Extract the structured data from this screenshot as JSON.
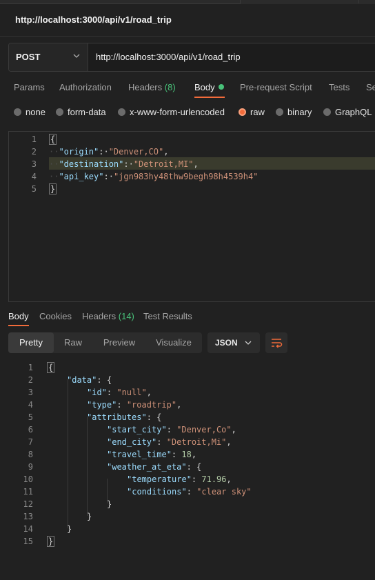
{
  "title": "http://localhost:3000/api/v1/road_trip",
  "request": {
    "method": "POST",
    "url": "http://localhost:3000/api/v1/road_trip"
  },
  "tabs": [
    {
      "label": "Params"
    },
    {
      "label": "Authorization"
    },
    {
      "label": "Headers",
      "count": "(8)"
    },
    {
      "label": "Body"
    },
    {
      "label": "Pre-request Script"
    },
    {
      "label": "Tests"
    },
    {
      "label": "Se"
    }
  ],
  "body_types": [
    "none",
    "form-data",
    "x-www-form-urlencoded",
    "raw",
    "binary",
    "GraphQL"
  ],
  "selected_body_type": "raw",
  "request_lines": [
    {
      "n": "1",
      "text": "{"
    },
    {
      "n": "2",
      "key": "\"origin\"",
      "value": "\"Denver,CO\"",
      "trail": ","
    },
    {
      "n": "3",
      "key": "\"destination\"",
      "value": "\"Detroit,MI\"",
      "trail": ","
    },
    {
      "n": "4",
      "key": "\"api_key\"",
      "value": "\"jgn983hy48thw9begh98h4539h4\"",
      "trail": ""
    },
    {
      "n": "5",
      "text": "}"
    }
  ],
  "response_tabs": [
    {
      "label": "Body"
    },
    {
      "label": "Cookies"
    },
    {
      "label": "Headers",
      "count": "(14)"
    },
    {
      "label": "Test Results"
    }
  ],
  "view_modes": [
    "Pretty",
    "Raw",
    "Preview",
    "Visualize"
  ],
  "format": "JSON",
  "response_lines": [
    {
      "n": "1",
      "text": "{"
    },
    {
      "n": "2",
      "text": "\"data\": {"
    },
    {
      "n": "3",
      "text": "\"id\": \"null\","
    },
    {
      "n": "4",
      "text": "\"type\": \"roadtrip\","
    },
    {
      "n": "5",
      "text": "\"attributes\": {"
    },
    {
      "n": "6",
      "text": "\"start_city\": \"Denver,Co\","
    },
    {
      "n": "7",
      "text": "\"end_city\": \"Detroit,Mi\","
    },
    {
      "n": "8",
      "text": "\"travel_time\": 18,"
    },
    {
      "n": "9",
      "text": "\"weather_at_eta\": {"
    },
    {
      "n": "10",
      "text": "\"temperature\": 71.96,"
    },
    {
      "n": "11",
      "text": "\"conditions\": \"clear sky\""
    },
    {
      "n": "12",
      "text": "}"
    },
    {
      "n": "13",
      "text": "}"
    },
    {
      "n": "14",
      "text": "}"
    },
    {
      "n": "15",
      "text": "}"
    }
  ],
  "colors": {
    "accent": "#f26b3a",
    "success": "#49c27a"
  }
}
